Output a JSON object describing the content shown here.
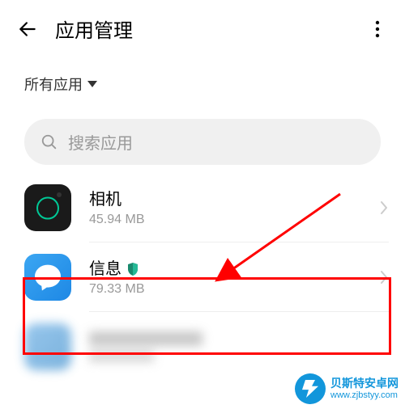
{
  "header": {
    "title": "应用管理"
  },
  "filter": {
    "label": "所有应用"
  },
  "search": {
    "placeholder": "搜索应用"
  },
  "apps": [
    {
      "name": "相机",
      "size": "45.94 MB",
      "icon": "camera-icon",
      "has_shield": false
    },
    {
      "name": "信息",
      "size": "79.33 MB",
      "icon": "messages-icon",
      "has_shield": true
    }
  ],
  "watermark": {
    "title": "贝斯特安卓网",
    "url": "www.zjbstyy.com"
  }
}
